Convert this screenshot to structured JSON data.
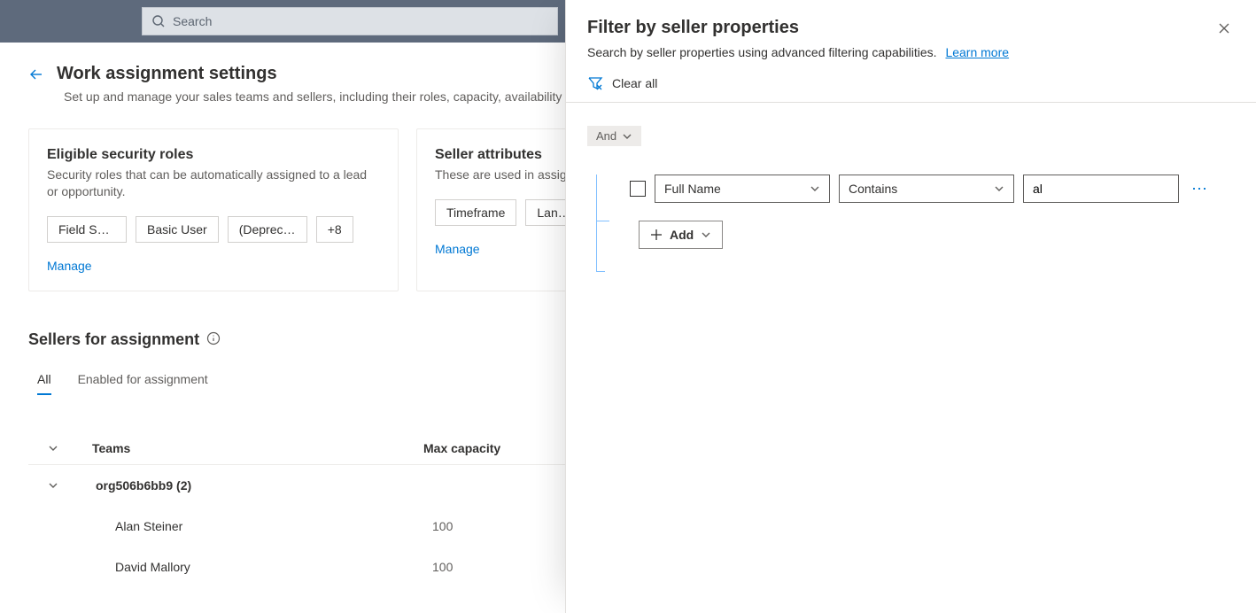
{
  "topbar": {
    "search_placeholder": "Search"
  },
  "page": {
    "title": "Work assignment settings",
    "description": "Set up and manage your sales teams and sellers, including their roles, capacity, availability a"
  },
  "cards": {
    "roles": {
      "title": "Eligible security roles",
      "description": "Security roles that can be automatically assigned to a lead or opportunity.",
      "chips": [
        "Field Servic...",
        "Basic User",
        "(Deprecate...",
        "+8"
      ],
      "manage": "Manage"
    },
    "attrs": {
      "title": "Seller attributes",
      "description": "These are used in assign",
      "chips": [
        "Timeframe",
        "Langua"
      ],
      "manage": "Manage"
    }
  },
  "sellers": {
    "title": "Sellers for assignment",
    "tabs": {
      "all": "All",
      "enabled": "Enabled for assignment"
    },
    "columns": {
      "teams": "Teams",
      "capacity": "Max capacity"
    },
    "group": "org506b6bb9 (2)",
    "rows": [
      {
        "name": "Alan Steiner",
        "capacity": "100"
      },
      {
        "name": "David Mallory",
        "capacity": "100"
      }
    ]
  },
  "panel": {
    "title": "Filter by seller properties",
    "subtitle": "Search by seller properties using advanced filtering capabilities.",
    "learn_more": "Learn more",
    "clear_all": "Clear all",
    "operator": "And",
    "field": "Full Name",
    "condition": "Contains",
    "value": "al",
    "add": "Add"
  }
}
